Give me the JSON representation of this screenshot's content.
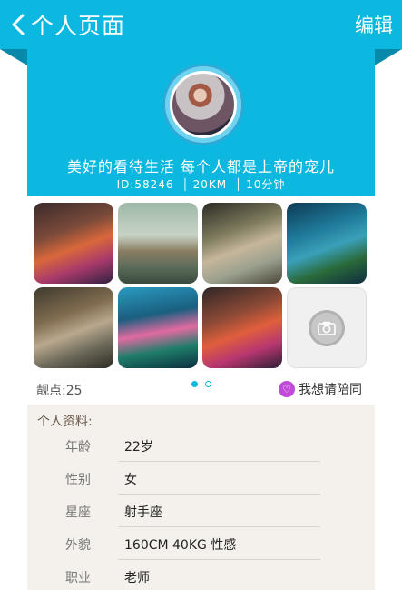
{
  "header": {
    "title": "个人页面",
    "edit_label": "编辑",
    "back_icon": "chevron-left-icon"
  },
  "profile": {
    "motto": "美好的看待生活  每个人都是上帝的宠儿",
    "id": "ID:58246",
    "distance": "20KM",
    "time": "10分钟"
  },
  "gallery": {
    "photos": [
      "photo-1",
      "photo-2",
      "photo-3",
      "photo-4",
      "photo-5",
      "photo-6",
      "photo-7"
    ],
    "add_icon": "camera-icon",
    "pages": 2,
    "current_page": 1
  },
  "stats": {
    "views": "靓点:25",
    "accompany_label": "我想请陪同"
  },
  "info": {
    "title": "个人资料:",
    "rows": [
      {
        "label": "年龄",
        "value": "22岁"
      },
      {
        "label": "性别",
        "value": "女"
      },
      {
        "label": "星座",
        "value": "射手座"
      },
      {
        "label": "外貌",
        "value": "160CM 40KG 性感"
      },
      {
        "label": "职业",
        "value": "老师"
      }
    ]
  },
  "colors": {
    "accent": "#0cb8e0",
    "fold": "#0789a9",
    "panel": "#f4f0eb"
  }
}
